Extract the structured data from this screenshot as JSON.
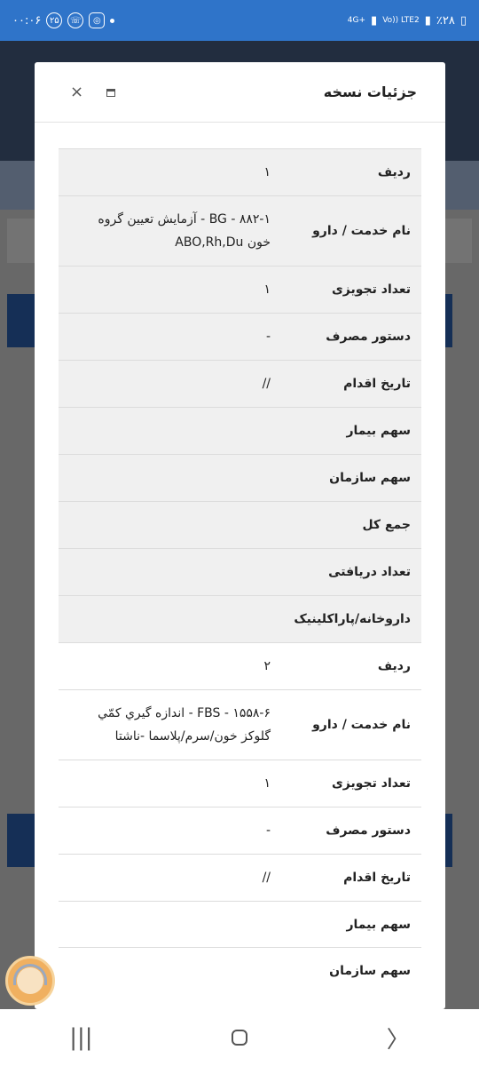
{
  "status_bar": {
    "time": "۰۰:۰۶",
    "notification_count": "۲۵",
    "battery": "٪۲۸",
    "network": "Vo)) LTE2",
    "network_type": "4G+"
  },
  "modal": {
    "title": "جزئیات نسخه",
    "close_symbol": "×"
  },
  "rows": [
    {
      "label": "ردیف",
      "value": "۱",
      "group": "a"
    },
    {
      "label": "نام خدمت / دارو",
      "value": "۸۸۲-۱ - BG - آزمایش تعیین گروه خون ABO,Rh,Du",
      "group": "a"
    },
    {
      "label": "تعداد تجویزی",
      "value": "۱",
      "group": "a"
    },
    {
      "label": "دستور مصرف",
      "value": "-",
      "group": "a"
    },
    {
      "label": "تاریخ اقدام",
      "value": "//",
      "group": "a"
    },
    {
      "label": "سهم بیمار",
      "value": "",
      "group": "a"
    },
    {
      "label": "سهم سازمان",
      "value": "",
      "group": "a"
    },
    {
      "label": "جمع کل",
      "value": "",
      "group": "a"
    },
    {
      "label": "تعداد دریافتی",
      "value": "",
      "group": "a"
    },
    {
      "label": "داروخانه/پاراکلینیک",
      "value": "",
      "group": "a"
    },
    {
      "label": "ردیف",
      "value": "۲",
      "group": "b"
    },
    {
      "label": "نام خدمت / دارو",
      "value": "۱۵۵۸-۶ - FBS - اندازه گيري كمّي گلوکز خون/سرم/پلاسما -ناشتا",
      "group": "b"
    },
    {
      "label": "تعداد تجویزی",
      "value": "۱",
      "group": "b"
    },
    {
      "label": "دستور مصرف",
      "value": "-",
      "group": "b"
    },
    {
      "label": "تاریخ اقدام",
      "value": "//",
      "group": "b"
    },
    {
      "label": "سهم بیمار",
      "value": "",
      "group": "b"
    },
    {
      "label": "سهم سازمان",
      "value": "",
      "group": "b"
    }
  ],
  "navbar": {
    "recent_symbol": "|||",
    "back_symbol": "〉"
  }
}
